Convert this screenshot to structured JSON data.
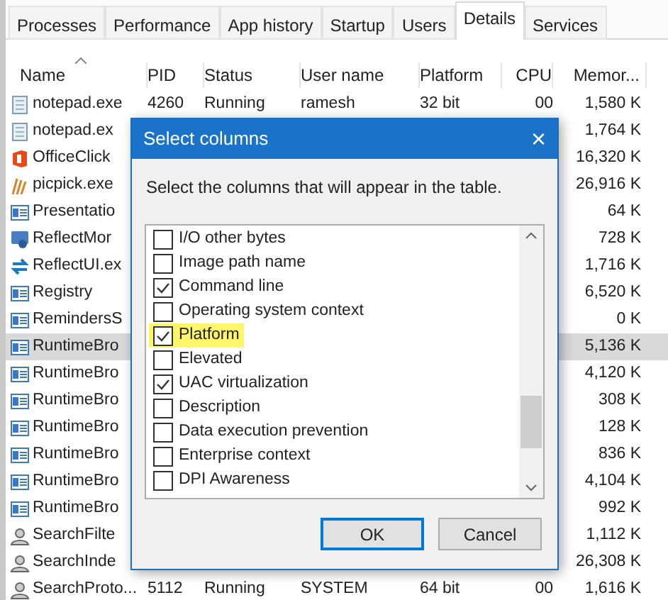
{
  "tabs": [
    {
      "label": "Processes",
      "selected": false
    },
    {
      "label": "Performance",
      "selected": false
    },
    {
      "label": "App history",
      "selected": false
    },
    {
      "label": "Startup",
      "selected": false
    },
    {
      "label": "Users",
      "selected": false
    },
    {
      "label": "Details",
      "selected": true
    },
    {
      "label": "Services",
      "selected": false
    }
  ],
  "table": {
    "columns": [
      "Name",
      "PID",
      "Status",
      "User name",
      "Platform",
      "CPU",
      "Memor..."
    ],
    "rows": [
      {
        "kind": "document",
        "name": "notepad.exe",
        "pid": "4260",
        "status": "Running",
        "user": "ramesh",
        "platform": "32 bit",
        "cpu": "00",
        "memory": "1,580 K",
        "selected": false
      },
      {
        "kind": "document",
        "name": "notepad.ex",
        "memory": "1,764 K",
        "selected": false
      },
      {
        "kind": "office",
        "name": "OfficeClick",
        "memory": "16,320 K",
        "selected": false
      },
      {
        "kind": "brush",
        "name": "picpick.exe",
        "memory": "26,916 K",
        "selected": false
      },
      {
        "kind": "window",
        "name": "Presentatio",
        "memory": "64 K",
        "selected": false
      },
      {
        "kind": "monitor",
        "name": "ReflectMor",
        "memory": "728 K",
        "selected": false
      },
      {
        "kind": "arrows",
        "name": "ReflectUI.ex",
        "memory": "1,716 K",
        "selected": false
      },
      {
        "kind": "window",
        "name": "Registry",
        "memory": "6,520 K",
        "selected": false
      },
      {
        "kind": "window",
        "name": "RemindersS",
        "memory": "0 K",
        "selected": false
      },
      {
        "kind": "window",
        "name": "RuntimeBro",
        "memory": "5,136 K",
        "selected": true
      },
      {
        "kind": "window",
        "name": "RuntimeBro",
        "memory": "4,120 K",
        "selected": false
      },
      {
        "kind": "window",
        "name": "RuntimeBro",
        "memory": "308 K",
        "selected": false
      },
      {
        "kind": "window",
        "name": "RuntimeBro",
        "memory": "128 K",
        "selected": false
      },
      {
        "kind": "window",
        "name": "RuntimeBro",
        "memory": "836 K",
        "selected": false
      },
      {
        "kind": "window",
        "name": "RuntimeBro",
        "memory": "4,104 K",
        "selected": false
      },
      {
        "kind": "window",
        "name": "RuntimeBro",
        "memory": "992 K",
        "selected": false
      },
      {
        "kind": "user",
        "name": "SearchFilte",
        "memory": "1,112 K",
        "selected": false
      },
      {
        "kind": "user",
        "name": "SearchInde",
        "memory": "26,308 K",
        "selected": false
      },
      {
        "kind": "user",
        "name": "SearchProto...",
        "pid": "5112",
        "status": "Running",
        "user": "SYSTEM",
        "platform": "64 bit",
        "cpu": "00",
        "memory": "1,616 K",
        "selected": false
      }
    ]
  },
  "dialog": {
    "title": "Select columns",
    "close": "×",
    "instruction": "Select the columns that will appear in the table.",
    "options": [
      {
        "label": "I/O other bytes",
        "checked": false,
        "highlighted": false
      },
      {
        "label": "Image path name",
        "checked": false,
        "highlighted": false
      },
      {
        "label": "Command line",
        "checked": true,
        "highlighted": false
      },
      {
        "label": "Operating system context",
        "checked": false,
        "highlighted": false
      },
      {
        "label": "Platform",
        "checked": true,
        "highlighted": true
      },
      {
        "label": "Elevated",
        "checked": false,
        "highlighted": false
      },
      {
        "label": "UAC virtualization",
        "checked": true,
        "highlighted": false
      },
      {
        "label": "Description",
        "checked": false,
        "highlighted": false
      },
      {
        "label": "Data execution prevention",
        "checked": false,
        "highlighted": false
      },
      {
        "label": "Enterprise context",
        "checked": false,
        "highlighted": false
      },
      {
        "label": "DPI Awareness",
        "checked": false,
        "highlighted": false
      }
    ],
    "buttons": [
      "OK",
      "Cancel"
    ]
  }
}
